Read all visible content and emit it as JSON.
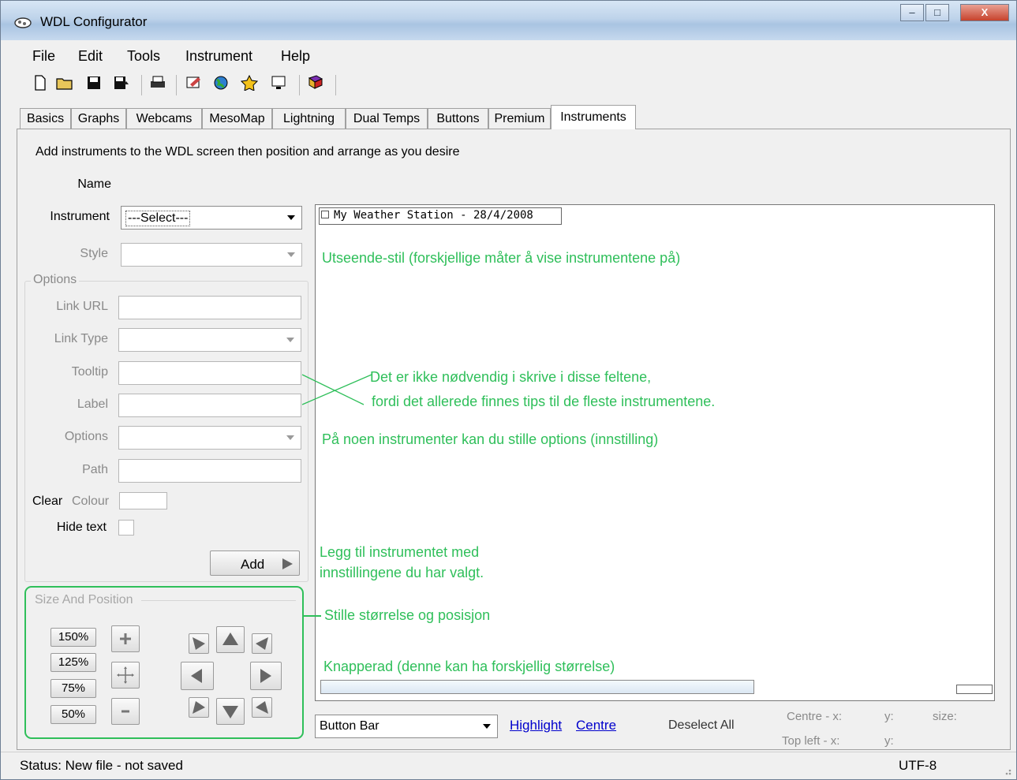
{
  "window": {
    "title": "WDL Configurator",
    "buttons": {
      "minimize": "–",
      "maximize": "□",
      "close": "X"
    }
  },
  "menu": {
    "items": [
      "File",
      "Edit",
      "Tools",
      "Instrument",
      "Help"
    ]
  },
  "toolbar": {
    "icons": [
      "new-file-icon",
      "open-folder-icon",
      "save-icon",
      "save-as-icon",
      "print-icon",
      "edit-text-icon",
      "globe-icon",
      "star-icon",
      "monitor-icon",
      "book-icon"
    ]
  },
  "tabs": [
    "Basics",
    "Graphs",
    "Webcams",
    "MesoMap",
    "Lightning",
    "Dual Temps",
    "Buttons",
    "Premium",
    "Instruments"
  ],
  "active_tab": "Instruments",
  "instructions": "Add instruments to the WDL screen then position and arrange as you desire",
  "form": {
    "name_label": "Name",
    "instrument_label": "Instrument",
    "instrument_value": "---Select---",
    "style_label": "Style",
    "options_group": "Options",
    "link_url_label": "Link URL",
    "link_type_label": "Link Type",
    "tooltip_label": "Tooltip",
    "label_label": "Label",
    "options_label": "Options",
    "path_label": "Path",
    "clear_label": "Clear",
    "colour_label": "Colour",
    "hide_text_label": "Hide text",
    "add_button": "Add"
  },
  "size_position": {
    "title": "Size And Position",
    "scale_buttons": [
      "150%",
      "125%",
      "75%",
      "50%"
    ]
  },
  "preview": {
    "station_title": "My Weather Station - 28/4/2008"
  },
  "annotations": {
    "style": "Utseende-stil (forskjellige måter å vise instrumentene på)",
    "fields_1": "Det er ikke nødvendig i skrive i disse feltene,",
    "fields_2": "fordi det allerede finnes tips til de fleste instrumentene.",
    "options": "På noen instrumenter kan du stille options (innstilling)",
    "add_1": "Legg til instrumentet med",
    "add_2": "innstillingene du har valgt.",
    "size": "Stille størrelse og posisjon",
    "buttonbar": "Knapperad (denne kan ha forskjellig størrelse)"
  },
  "bottom": {
    "combo_value": "Button Bar",
    "highlight": "Highlight",
    "centre": "Centre",
    "deselect_all": "Deselect All",
    "centre_x": "Centre - x:",
    "y1": "y:",
    "size": "size:",
    "topleft_x": "Top left - x:",
    "y2": "y:"
  },
  "status": {
    "text": "Status: New file - not saved",
    "encoding": "UTF-8"
  }
}
